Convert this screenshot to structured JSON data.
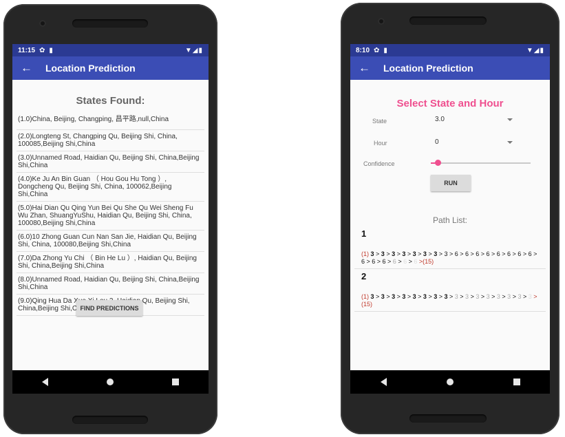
{
  "left_phone": {
    "status_time": "11:15",
    "app_title": "Location Prediction",
    "states_title": "States Found:",
    "states": [
      "(1.0)China, Beijing, Changping, 昌平路,null,China",
      "(2.0)Longteng St, Changping Qu, Beijing Shi, China, 100085,Beijing Shi,China",
      "(3.0)Unnamed Road, Haidian Qu, Beijing Shi, China,Beijing Shi,China",
      "(4.0)Ke Ju An Bin Guan （ Hou Gou Hu Tong ）, Dongcheng Qu, Beijing Shi, China, 100062,Beijing Shi,China",
      "(5.0)Hai Dian Qu Qing Yun Bei Qu She Qu Wei Sheng Fu Wu Zhan, ShuangYuShu, Haidian Qu, Beijing Shi, China, 100080,Beijing Shi,China",
      "(6.0)10 Zhong Guan Cun Nan San Jie, Haidian Qu, Beijing Shi, China, 100080,Beijing Shi,China",
      "(7.0)Da Zhong Yu Chi （ Bin He Lu ）, Haidian Qu, Beijing Shi, China,Beijing Shi,China",
      "(8.0)Unnamed Road, Haidian Qu, Beijing Shi, China,Beijing Shi,China",
      "(9.0)Qing Hua Da Xue Xi Lou 2, Haidian Qu, Beijing Shi, China,Beijing Shi,China"
    ],
    "find_button": "FIND PREDICTIONS"
  },
  "right_phone": {
    "status_time": "8:10",
    "app_title": "Location Prediction",
    "select_title": "Select State and Hour",
    "state_label": "State",
    "state_value": "3.0",
    "hour_label": "Hour",
    "hour_value": "0",
    "confidence_label": "Confidence",
    "confidence_level": 0.07,
    "run_button": "RUN",
    "path_list_title": "Path List:",
    "paths": [
      {
        "num": "1",
        "start": "(1)",
        "end": ">(15)"
      },
      {
        "num": "2",
        "start": "(1)",
        "end": ">(15)"
      }
    ]
  },
  "colors": {
    "app_bar": "#3b4db5",
    "status_bar": "#2b3a93",
    "accent": "#ef4f8f"
  },
  "icons": [
    "back-arrow-icon",
    "gear-icon",
    "sd-card-icon",
    "wifi-icon",
    "signal-icon",
    "battery-icon",
    "nav-back-icon",
    "nav-home-icon",
    "nav-recent-icon"
  ]
}
